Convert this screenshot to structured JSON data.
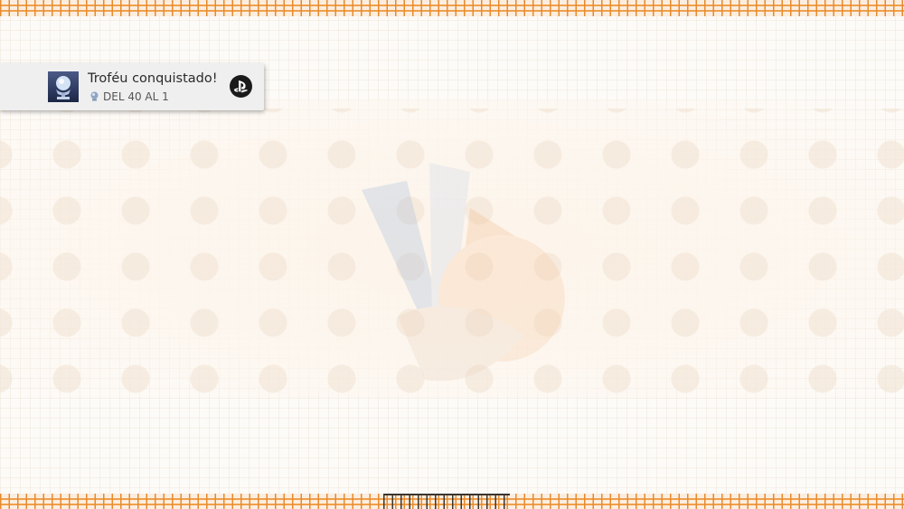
{
  "notification": {
    "title": "Troféu conquistado!",
    "trophy_name": "DEL 40 AL 1",
    "trophy_grade": "platinum",
    "icons": {
      "trophy": "trophy-icon",
      "grade": "platinum-trophy-icon",
      "system": "playstation-icon"
    }
  },
  "colors": {
    "border_accent": "#e88a2e",
    "toast_background": "#efefef",
    "page_background": "#fdfbf8"
  }
}
